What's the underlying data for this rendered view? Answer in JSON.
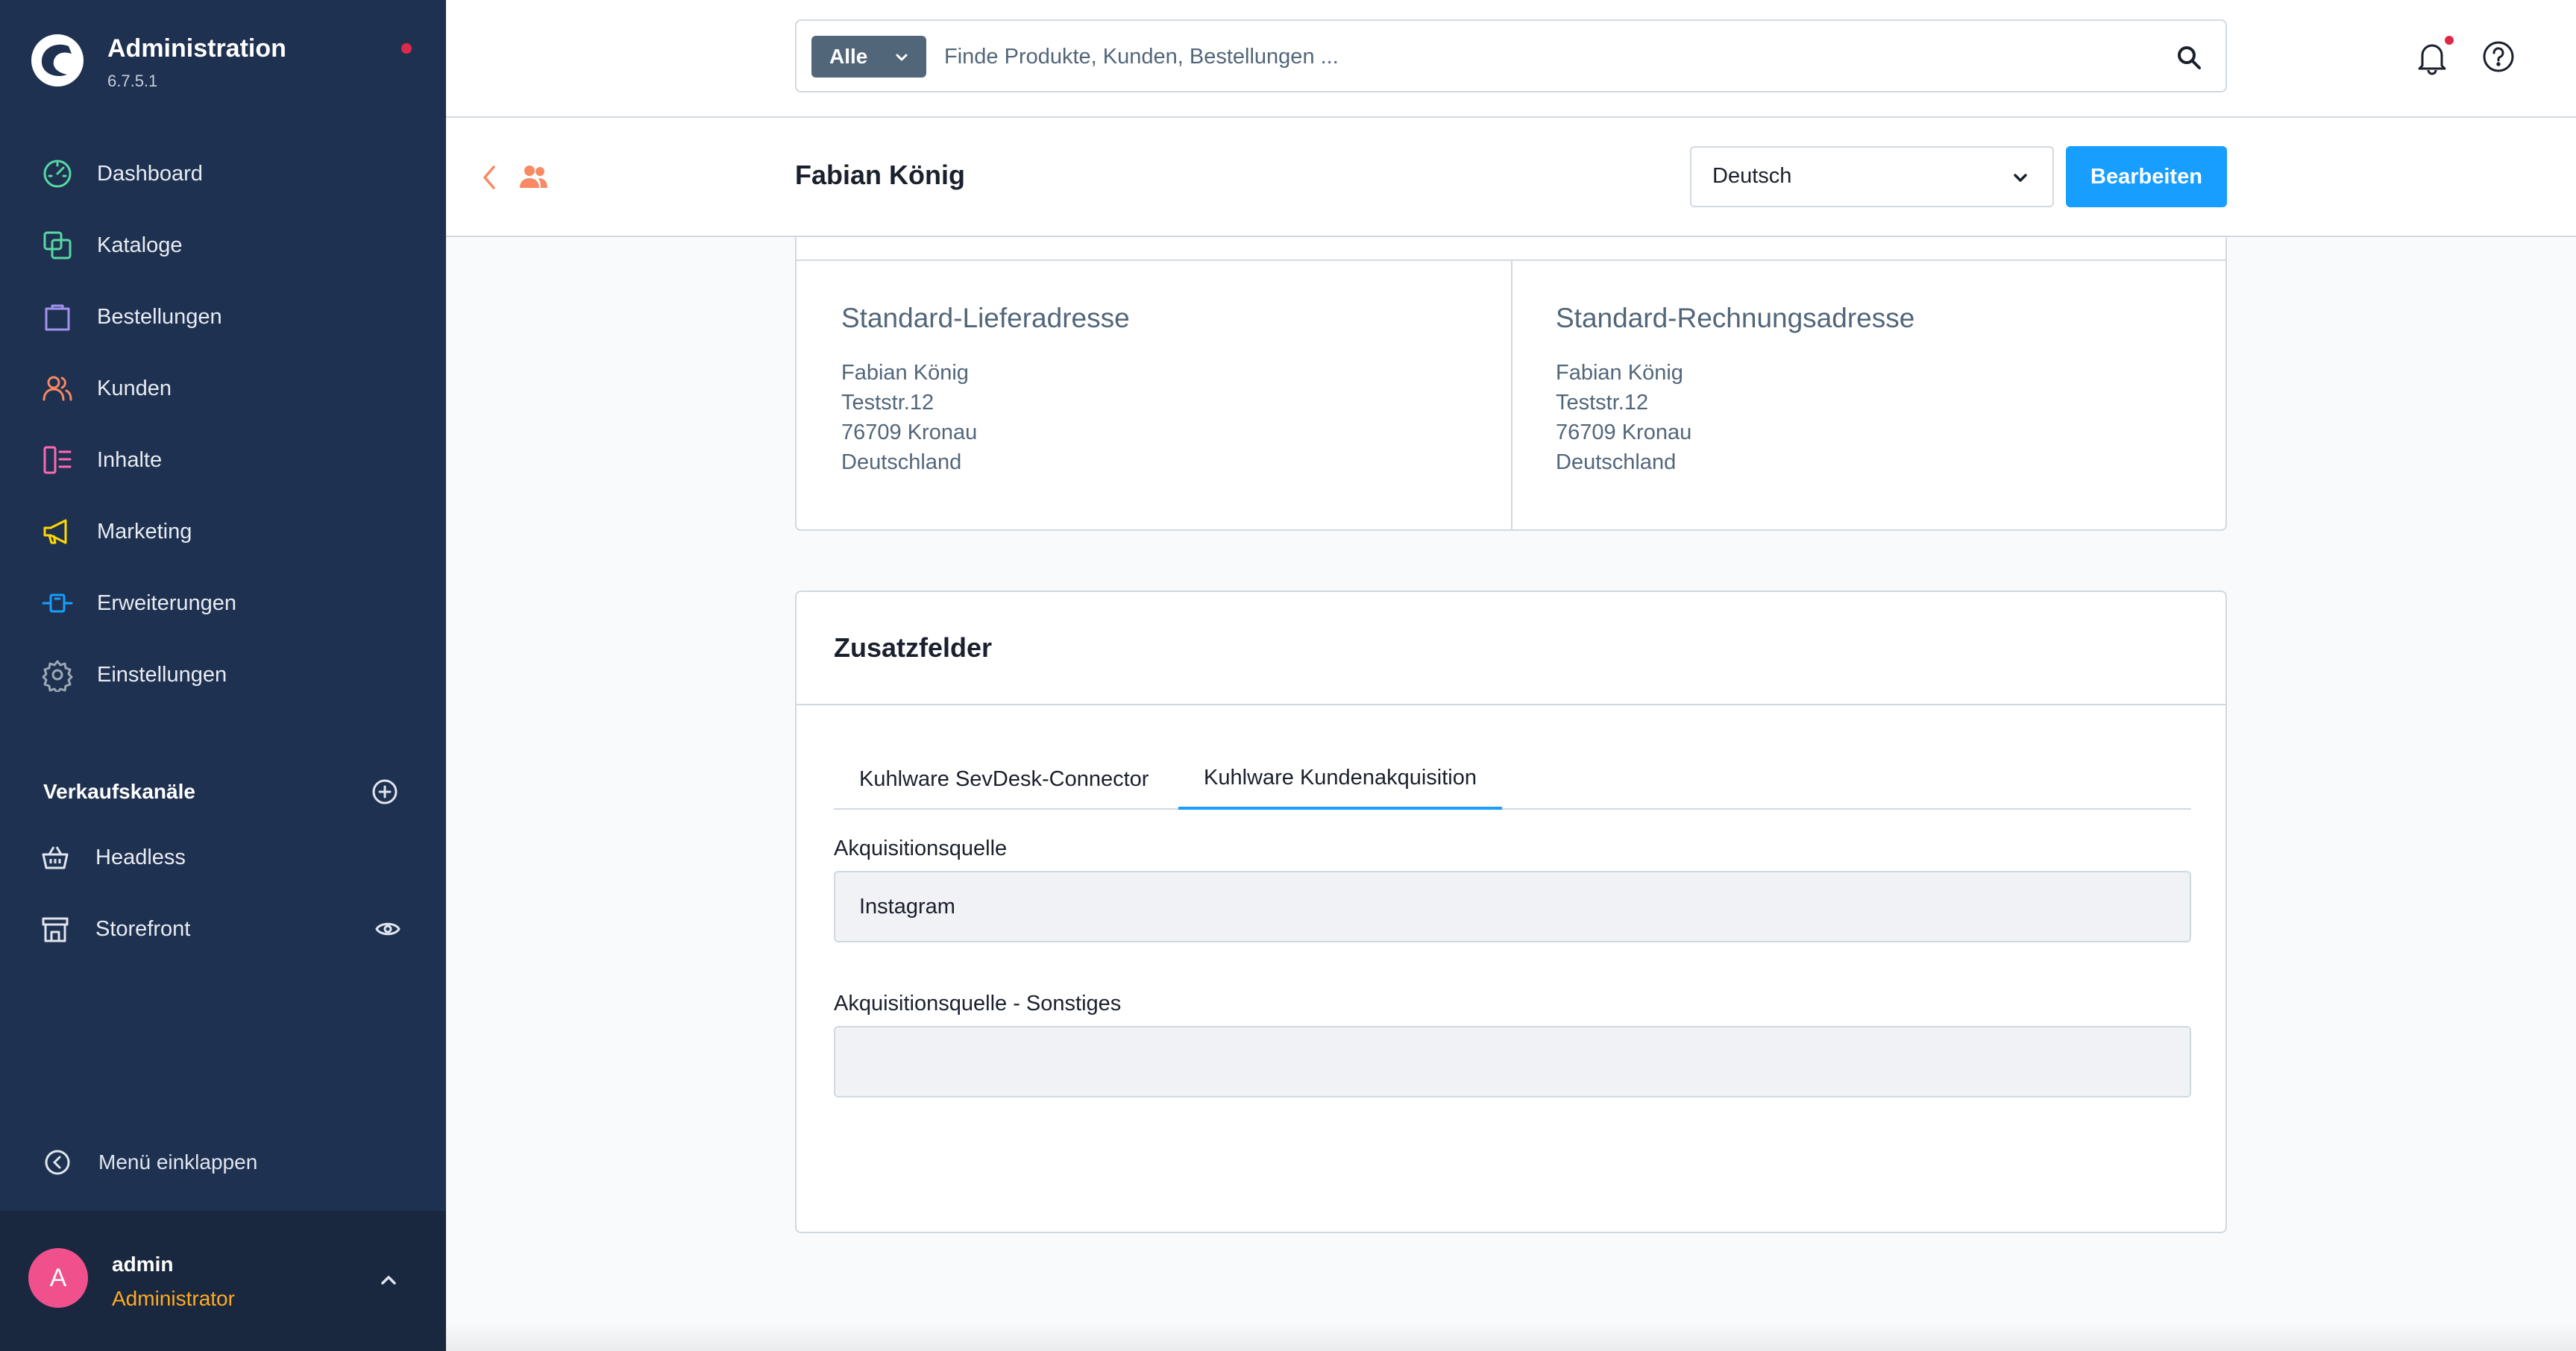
{
  "app": {
    "title": "Administration",
    "version": "6.7.5.1"
  },
  "sidebar": {
    "nav": [
      {
        "label": "Dashboard",
        "icon": "dashboard-icon",
        "color": "#57d9a3"
      },
      {
        "label": "Kataloge",
        "icon": "catalog-icon",
        "color": "#57d9a3"
      },
      {
        "label": "Bestellungen",
        "icon": "orders-icon",
        "color": "#a092f0"
      },
      {
        "label": "Kunden",
        "icon": "customers-icon",
        "color": "#f88962"
      },
      {
        "label": "Inhalte",
        "icon": "content-icon",
        "color": "#ff68b4"
      },
      {
        "label": "Marketing",
        "icon": "marketing-icon",
        "color": "#ffd700"
      },
      {
        "label": "Erweiterungen",
        "icon": "extensions-icon",
        "color": "#189eff"
      },
      {
        "label": "Einstellungen",
        "icon": "settings-icon",
        "color": "#9aa8b5"
      }
    ],
    "sales_channels": {
      "title": "Verkaufskanäle",
      "items": [
        {
          "label": "Headless",
          "icon": "basket-icon"
        },
        {
          "label": "Storefront",
          "icon": "storefront-icon"
        }
      ]
    },
    "collapse_label": "Menü einklappen",
    "user": {
      "initial": "A",
      "name": "admin",
      "role": "Administrator"
    }
  },
  "topbar": {
    "search_scope": "Alle",
    "search_placeholder": "Finde Produkte, Kunden, Bestellungen ..."
  },
  "page": {
    "title": "Fabian König",
    "language": "Deutsch",
    "edit_label": "Bearbeiten"
  },
  "addresses": {
    "shipping": {
      "title": "Standard-Lieferadresse",
      "lines": [
        "Fabian König",
        "Teststr.12",
        "76709 Kronau",
        "Deutschland"
      ]
    },
    "billing": {
      "title": "Standard-Rechnungsadresse",
      "lines": [
        "Fabian König",
        "Teststr.12",
        "76709 Kronau",
        "Deutschland"
      ]
    }
  },
  "custom_fields": {
    "title": "Zusatzfelder",
    "tabs": [
      {
        "label": "Kuhlware SevDesk-Connector",
        "active": false
      },
      {
        "label": "Kuhlware Kundenakquisition",
        "active": true
      }
    ],
    "fields": [
      {
        "label": "Akquisitionsquelle",
        "value": "Instagram"
      },
      {
        "label": "Akquisitionsquelle - Sonstiges",
        "value": ""
      }
    ]
  },
  "colors": {
    "sidebar_bg": "#1f3150",
    "primary": "#189eff",
    "user_role": "#ffab22",
    "avatar": "#f0508c",
    "notification_dot": "#de294c"
  }
}
